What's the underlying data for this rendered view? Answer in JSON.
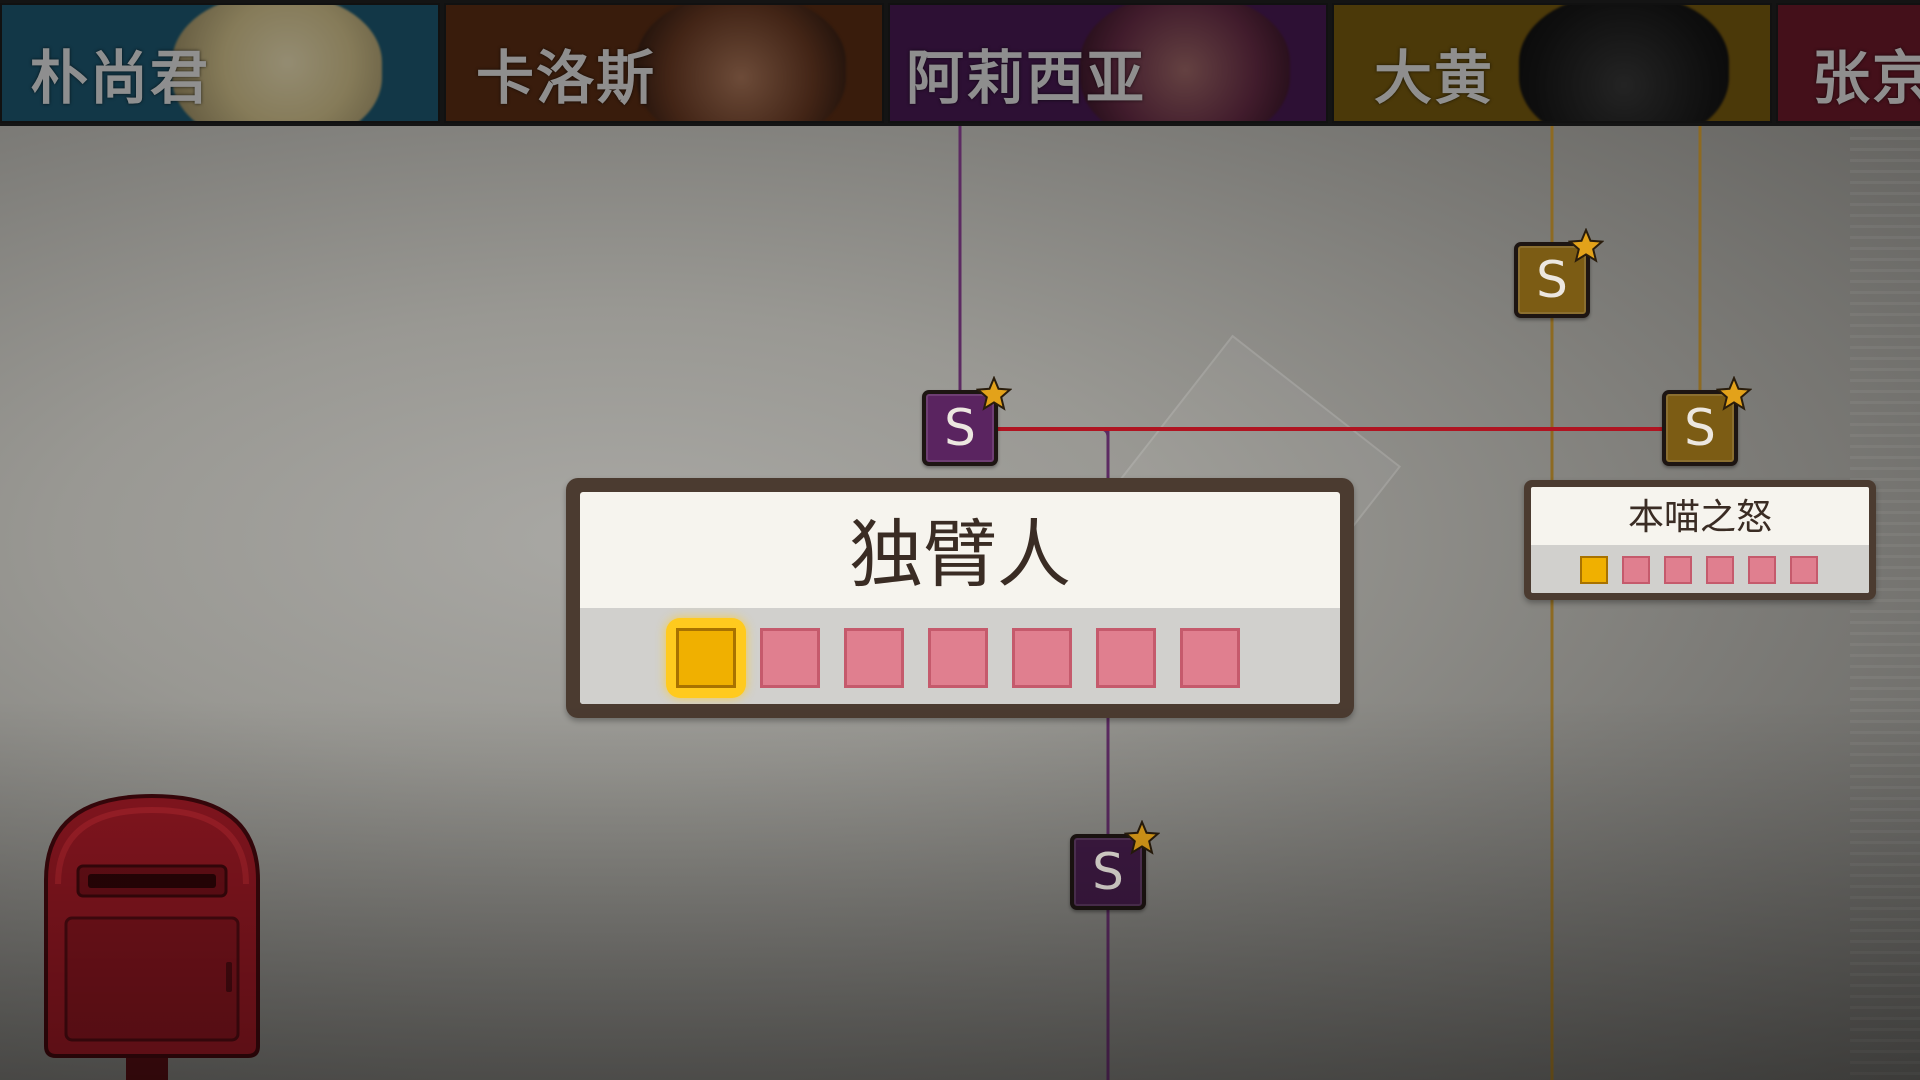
{
  "characters": [
    {
      "name": "朴尚君",
      "color": "#1d5a73",
      "portrait": "blonde-man-portrait"
    },
    {
      "name": "卡洛斯",
      "color": "#5c2e14",
      "portrait": "dark-haired-man-portrait"
    },
    {
      "name": "阿莉西亚",
      "color": "#4a1a55",
      "portrait": "woman-portrait"
    },
    {
      "name": "大黄",
      "color": "#7a5c10",
      "portrait": "cat-portrait"
    },
    {
      "name": "张京",
      "color": "#6e1a2a",
      "portrait": "man-portrait"
    }
  ],
  "nodes": [
    {
      "letter": "S",
      "character": "阿莉西亚",
      "starred": true,
      "color": "#5a2460"
    },
    {
      "letter": "S",
      "character": "阿莉西亚",
      "starred": true,
      "color": "#5a2460"
    },
    {
      "letter": "S",
      "character": "大黄",
      "starred": true,
      "color": "#7c5c14"
    },
    {
      "letter": "S",
      "character": "大黄",
      "starred": true,
      "color": "#7c5c14"
    }
  ],
  "main_panel": {
    "title": "独臂人",
    "squares": [
      "gold",
      "pink",
      "pink",
      "pink",
      "pink",
      "pink",
      "pink"
    ],
    "selected_index": 0
  },
  "side_panel": {
    "title": "本喵之怒",
    "squares": [
      "gold",
      "pink",
      "pink",
      "pink",
      "pink",
      "pink"
    ]
  },
  "icons": {
    "star": "star-icon",
    "mailbox": "mailbox-icon"
  },
  "colors": {
    "link_line": "#b01421",
    "alicia_line": "#5c2a62",
    "dahuang_line": "#8d6a22",
    "panel_border": "#4b3b30",
    "square_pink": "#e07f8f",
    "square_gold": "#f0b000"
  }
}
